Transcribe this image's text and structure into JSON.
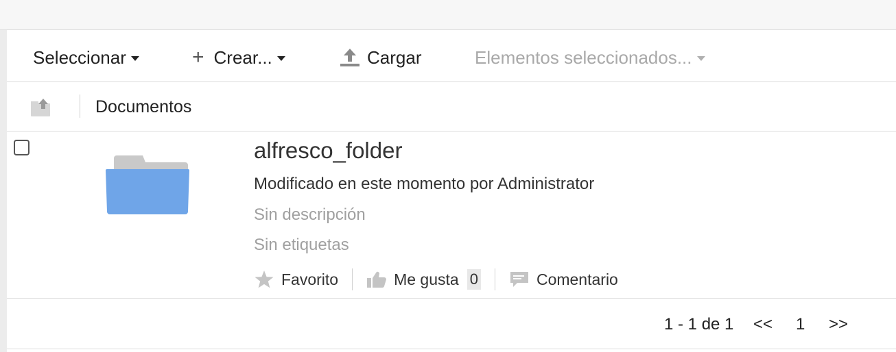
{
  "toolbar": {
    "select_label": "Seleccionar",
    "create_label": "Crear...",
    "upload_label": "Cargar",
    "selected_items_label": "Elementos seleccionados..."
  },
  "path": {
    "breadcrumb": "Documentos"
  },
  "items": [
    {
      "name": "alfresco_folder",
      "modified": "Modificado en este momento por Administrator",
      "description": "Sin descripción",
      "tags": "Sin etiquetas",
      "favorite_label": "Favorito",
      "like_label": "Me gusta",
      "like_count": "0",
      "comment_label": "Comentario"
    }
  ],
  "pagination": {
    "range": "1 - 1 de 1",
    "first": "<<",
    "page": "1",
    "next": ">>"
  },
  "colors": {
    "folder_body": "#6fa5e8",
    "folder_tab": "#c9c9c9",
    "disabled_text": "#a9a9a9"
  }
}
